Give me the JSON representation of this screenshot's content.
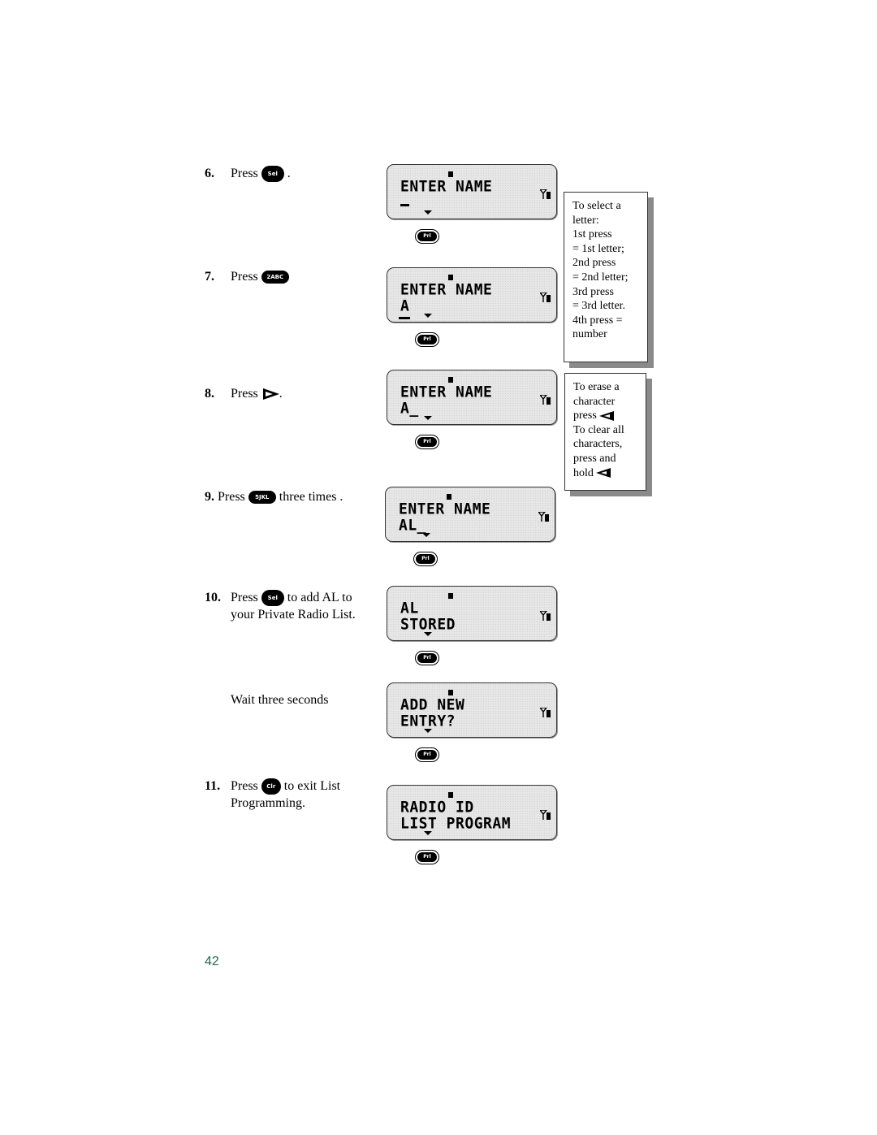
{
  "steps": [
    {
      "number": "6.",
      "pre": "Press",
      "key": "Sel",
      "post": "."
    },
    {
      "number": "7.",
      "pre": "Press",
      "key": "2ABC",
      "post": ""
    },
    {
      "number": "8.",
      "pre": "Press",
      "key": "right-arrow",
      "post": "."
    },
    {
      "number": "9.",
      "pre": "Press",
      "key": "5JKL",
      "post": "three times ."
    },
    {
      "number": "10.",
      "pre": "Press",
      "key": "Sel",
      "post": "to add AL to",
      "line2": "your Private Radio List."
    },
    {
      "number": "",
      "pre": "Wait three seconds",
      "key": "",
      "post": ""
    },
    {
      "number": "11.",
      "pre": "Press",
      "key": "Clr",
      "post": "to exit List",
      "line2": "Programming."
    }
  ],
  "displays": [
    {
      "line1": "ENTER NAME",
      "line2": "_",
      "fn_key": "Prl"
    },
    {
      "line1": "ENTER NAME",
      "line2": "A",
      "fn_key": "Prl"
    },
    {
      "line1": "ENTER NAME",
      "line2": "A_",
      "fn_key": "Prl"
    },
    {
      "line1": "ENTER NAME",
      "line2": "AL_",
      "fn_key": "Prl"
    },
    {
      "line1": "AL",
      "line2": "STORED",
      "fn_key": "Prl"
    },
    {
      "line1": "ADD NEW",
      "line2": "ENTRY?",
      "fn_key": "Prl"
    },
    {
      "line1": "RADIO ID",
      "line2": "LIST PROGRAM",
      "fn_key": "Prl"
    }
  ],
  "notes": {
    "select_letter": [
      "To select a",
      "letter:",
      "1st press",
      "=  1st letter;",
      "2nd press",
      "= 2nd letter;",
      "3rd press",
      "= 3rd letter.",
      "4th press  =",
      "number"
    ],
    "erase": {
      "line1": "To erase a",
      "line2": "character",
      "line3": "press",
      "line4": "To clear all",
      "line5": "characters,",
      "line6": "press and",
      "line7": "hold"
    }
  },
  "page_number": "42"
}
